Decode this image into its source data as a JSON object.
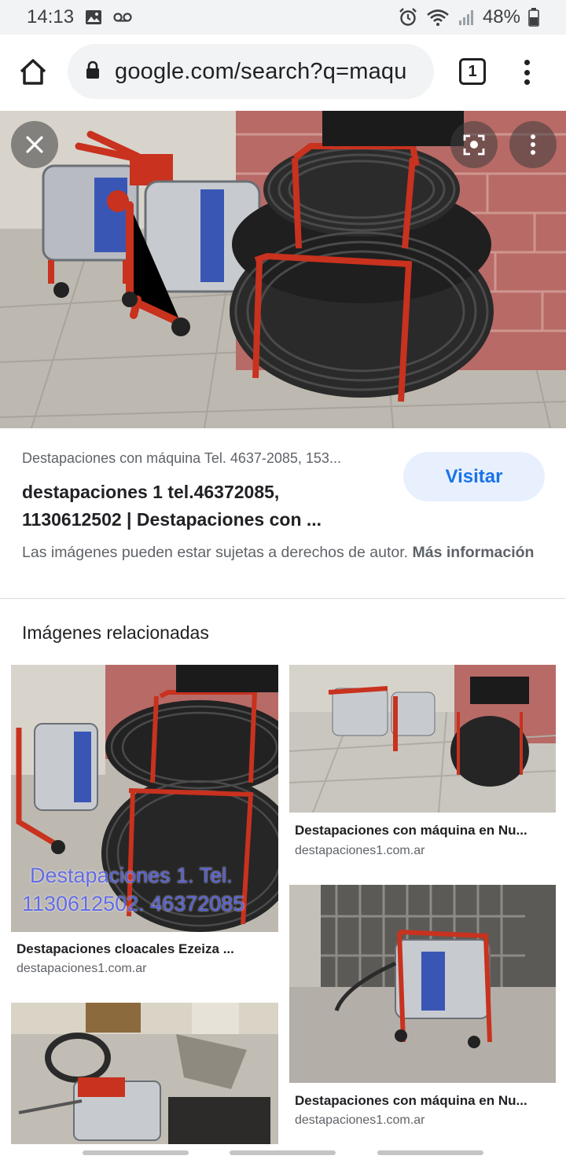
{
  "status_bar": {
    "time": "14:13",
    "battery": "48%"
  },
  "browser": {
    "url": "google.com/search?q=maqu",
    "tab_count": "1"
  },
  "result": {
    "source": "Destapaciones con máquina Tel. 4637-2085, 153...",
    "visit_label": "Visitar",
    "title_line1": "destapaciones 1 tel.46372085,",
    "title_line2": "1130612502 | Destapaciones con ...",
    "copyright_text": "Las imágenes pueden estar sujetas a derechos de autor.",
    "copyright_link": "Más información"
  },
  "related": {
    "heading": "Imágenes relacionadas",
    "overlay_text_line1": "Destapaciones 1. Tel.",
    "overlay_text_line2": "1130612502. 46372085",
    "items": [
      {
        "title": "Destapaciones cloacales Ezeiza ...",
        "domain": "destapaciones1.com.ar"
      },
      {
        "title": "Destapaciones con máquina en Nu...",
        "domain": "destapaciones1.com.ar"
      },
      {
        "title": "Destapaciones con máquina en Nu...",
        "domain": "destapaciones1.com.ar"
      }
    ]
  },
  "colors": {
    "accent": "#1a73e8",
    "visit_bg": "#e8f0fe",
    "machine_red": "#c8321e",
    "brick": "#b86a66"
  },
  "icons": [
    "home-icon",
    "lock-icon",
    "tab-switcher-icon",
    "more-vert-icon",
    "close-icon",
    "lens-icon"
  ]
}
